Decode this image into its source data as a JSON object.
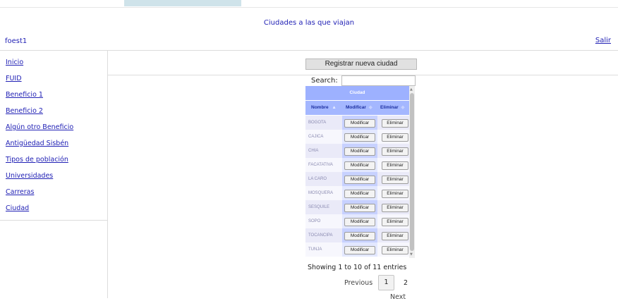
{
  "header": {
    "title": "Ciudades a las que viajan",
    "user": "foest1",
    "logout": "Salir"
  },
  "sidebar": {
    "items": [
      {
        "label": "Inicio"
      },
      {
        "label": "FUID"
      },
      {
        "label": "Beneficio 1"
      },
      {
        "label": "Beneficio 2"
      },
      {
        "label": "Algún otro Beneficio"
      },
      {
        "label": "Antigüedad Sisbén"
      },
      {
        "label": "Tipos de población"
      },
      {
        "label": "Universidades"
      },
      {
        "label": "Carreras"
      },
      {
        "label": "Ciudad"
      }
    ]
  },
  "main": {
    "register_button": "Registrar nueva ciudad",
    "search_label": "Search:",
    "search_value": "",
    "table": {
      "group_header": "Ciudad",
      "columns": [
        "Nombre",
        "Modificar",
        "Eliminar"
      ],
      "sort_icon": "sort-asc-icon",
      "rows": [
        {
          "nombre": "BOGOTA",
          "modificar": "Modificar",
          "eliminar": "Eliminar"
        },
        {
          "nombre": "CAJICA",
          "modificar": "Modificar",
          "eliminar": "Eliminar"
        },
        {
          "nombre": "CHIA",
          "modificar": "Modificar",
          "eliminar": "Eliminar"
        },
        {
          "nombre": "FACATATIVA",
          "modificar": "Modificar",
          "eliminar": "Eliminar"
        },
        {
          "nombre": "LA CARO",
          "modificar": "Modificar",
          "eliminar": "Eliminar"
        },
        {
          "nombre": "MOSQUERA",
          "modificar": "Modificar",
          "eliminar": "Eliminar"
        },
        {
          "nombre": "SESQUILE",
          "modificar": "Modificar",
          "eliminar": "Eliminar"
        },
        {
          "nombre": "SOPO",
          "modificar": "Modificar",
          "eliminar": "Eliminar"
        },
        {
          "nombre": "TOCANCIPA",
          "modificar": "Modificar",
          "eliminar": "Eliminar"
        },
        {
          "nombre": "TUNJA",
          "modificar": "Modificar",
          "eliminar": "Eliminar"
        }
      ]
    },
    "info": "Showing 1 to 10 of 11 entries",
    "pagination": {
      "previous": "Previous",
      "pages": [
        "1",
        "2"
      ],
      "current": "1",
      "next": "Next"
    }
  },
  "colors": {
    "link": "#2121b5",
    "table_header": "#9db1ff",
    "row_odd_a": "#eaeaf8",
    "row_odd_b": "#c7d1ff",
    "row_even_a": "#f7f7fd",
    "row_even_b": "#e3e8ff"
  }
}
